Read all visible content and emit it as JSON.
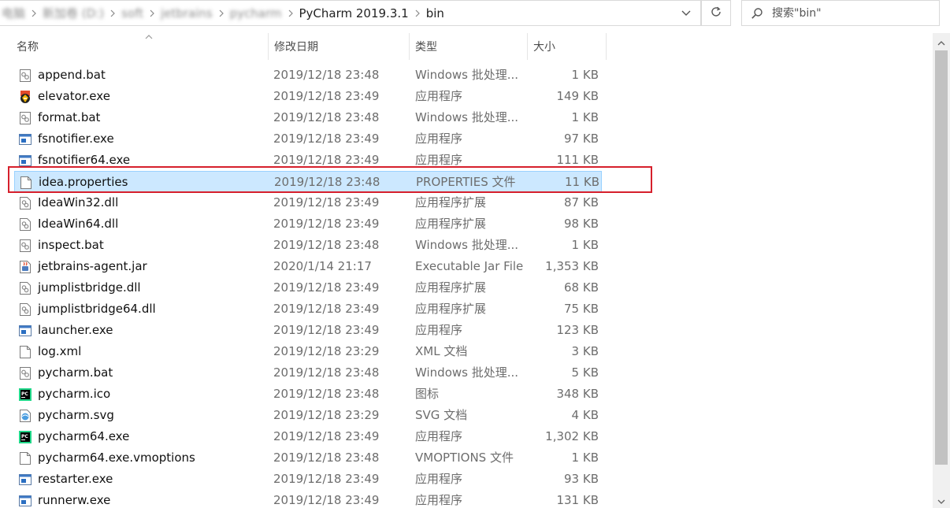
{
  "addressbar": {
    "crumbs": [
      {
        "label": "电脑",
        "blurred": true
      },
      {
        "label": "新加卷 (D:)",
        "blurred": true
      },
      {
        "label": "soft",
        "blurred": true
      },
      {
        "label": "jetbrains",
        "blurred": true
      },
      {
        "label": "pycharm",
        "blurred": true
      },
      {
        "label": "PyCharm 2019.3.1",
        "blurred": false
      },
      {
        "label": "bin",
        "blurred": false
      }
    ],
    "dropdown_icon": "chevron-down-icon",
    "refresh_icon": "refresh-icon"
  },
  "search": {
    "placeholder": "搜索\"bin\"",
    "icon": "search-icon"
  },
  "columns": {
    "name": "名称",
    "date": "修改日期",
    "type": "类型",
    "size": "大小"
  },
  "files": [
    {
      "name": "append.bat",
      "date": "2019/12/18 23:48",
      "type": "Windows 批处理...",
      "size": "1 KB",
      "icon": "bat-icon"
    },
    {
      "name": "elevator.exe",
      "date": "2019/12/18 23:49",
      "type": "应用程序",
      "size": "149 KB",
      "icon": "elevator-exe-icon"
    },
    {
      "name": "format.bat",
      "date": "2019/12/18 23:48",
      "type": "Windows 批处理...",
      "size": "1 KB",
      "icon": "bat-icon"
    },
    {
      "name": "fsnotifier.exe",
      "date": "2019/12/18 23:49",
      "type": "应用程序",
      "size": "97 KB",
      "icon": "exe-icon"
    },
    {
      "name": "fsnotifier64.exe",
      "date": "2019/12/18 23:49",
      "type": "应用程序",
      "size": "111 KB",
      "icon": "exe-icon"
    },
    {
      "name": "idea.properties",
      "date": "2019/12/18 23:48",
      "type": "PROPERTIES 文件",
      "size": "11 KB",
      "icon": "file-icon",
      "selected": true
    },
    {
      "name": "IdeaWin32.dll",
      "date": "2019/12/18 23:49",
      "type": "应用程序扩展",
      "size": "87 KB",
      "icon": "dll-icon"
    },
    {
      "name": "IdeaWin64.dll",
      "date": "2019/12/18 23:49",
      "type": "应用程序扩展",
      "size": "98 KB",
      "icon": "dll-icon"
    },
    {
      "name": "inspect.bat",
      "date": "2019/12/18 23:48",
      "type": "Windows 批处理...",
      "size": "1 KB",
      "icon": "bat-icon"
    },
    {
      "name": "jetbrains-agent.jar",
      "date": "2020/1/14 21:17",
      "type": "Executable Jar File",
      "size": "1,353 KB",
      "icon": "jar-icon"
    },
    {
      "name": "jumplistbridge.dll",
      "date": "2019/12/18 23:49",
      "type": "应用程序扩展",
      "size": "68 KB",
      "icon": "dll-icon"
    },
    {
      "name": "jumplistbridge64.dll",
      "date": "2019/12/18 23:49",
      "type": "应用程序扩展",
      "size": "75 KB",
      "icon": "dll-icon"
    },
    {
      "name": "launcher.exe",
      "date": "2019/12/18 23:49",
      "type": "应用程序",
      "size": "123 KB",
      "icon": "exe-icon"
    },
    {
      "name": "log.xml",
      "date": "2019/12/18 23:29",
      "type": "XML 文档",
      "size": "3 KB",
      "icon": "file-icon"
    },
    {
      "name": "pycharm.bat",
      "date": "2019/12/18 23:48",
      "type": "Windows 批处理...",
      "size": "5 KB",
      "icon": "bat-icon"
    },
    {
      "name": "pycharm.ico",
      "date": "2019/12/18 23:48",
      "type": "图标",
      "size": "348 KB",
      "icon": "pycharm-icon"
    },
    {
      "name": "pycharm.svg",
      "date": "2019/12/18 23:29",
      "type": "SVG 文档",
      "size": "4 KB",
      "icon": "svg-icon"
    },
    {
      "name": "pycharm64.exe",
      "date": "2019/12/18 23:49",
      "type": "应用程序",
      "size": "1,302 KB",
      "icon": "pycharm-icon"
    },
    {
      "name": "pycharm64.exe.vmoptions",
      "date": "2019/12/18 23:48",
      "type": "VMOPTIONS 文件",
      "size": "1 KB",
      "icon": "file-icon"
    },
    {
      "name": "restarter.exe",
      "date": "2019/12/18 23:49",
      "type": "应用程序",
      "size": "93 KB",
      "icon": "exe-icon"
    },
    {
      "name": "runnerw.exe",
      "date": "2019/12/18 23:49",
      "type": "应用程序",
      "size": "131 KB",
      "icon": "exe-icon"
    }
  ],
  "colors": {
    "selection_bg": "#cce8ff",
    "selection_border": "#99d1ff",
    "annotation_red": "#d6202c",
    "secondary_text": "#6d6d6d"
  }
}
